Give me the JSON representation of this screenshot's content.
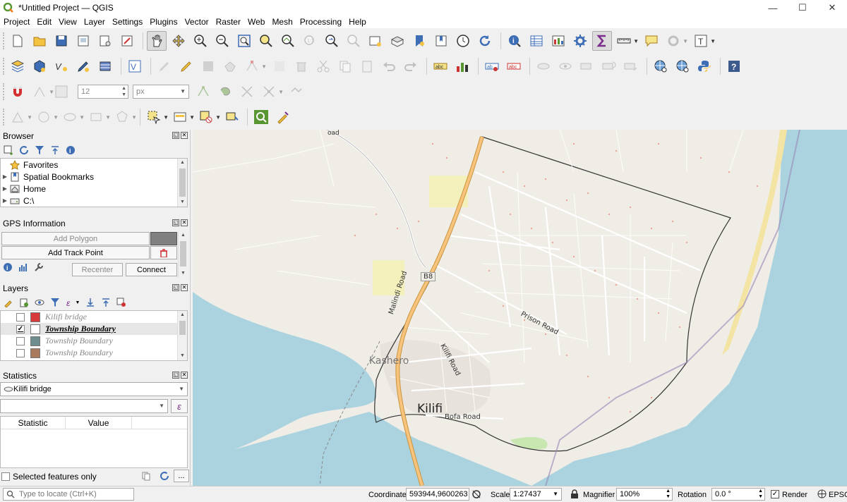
{
  "window": {
    "title": "*Untitled Project — QGIS",
    "controls": [
      "—",
      "☐",
      "✕"
    ]
  },
  "menu": [
    "Project",
    "Edit",
    "View",
    "Layer",
    "Settings",
    "Plugins",
    "Vector",
    "Raster",
    "Web",
    "Mesh",
    "Processing",
    "Help"
  ],
  "snapping": {
    "tolerance": "12",
    "units": "px"
  },
  "browser": {
    "title": "Browser",
    "items": [
      {
        "label": "Favorites",
        "icon": "star-icon"
      },
      {
        "label": "Spatial Bookmarks",
        "icon": "bookmark-icon"
      },
      {
        "label": "Home",
        "icon": "home-icon"
      },
      {
        "label": "C:\\",
        "icon": "drive-icon"
      }
    ]
  },
  "gps": {
    "title": "GPS Information",
    "add_polygon": "Add Polygon",
    "add_track_point": "Add Track Point",
    "recenter": "Recenter",
    "connect": "Connect"
  },
  "layers": {
    "title": "Layers",
    "items": [
      {
        "label": "Kilifi bridge",
        "checked": false,
        "color": "#d63a3a",
        "selected": false
      },
      {
        "label": "Township Boundary",
        "checked": true,
        "color": "#ffffff",
        "selected": true
      },
      {
        "label": "Township Boundary",
        "checked": false,
        "color": "#6f8d8e",
        "selected": false
      },
      {
        "label": "Township Boundary",
        "checked": false,
        "color": "#a97b5c",
        "selected": false
      }
    ]
  },
  "statistics": {
    "title": "Statistics",
    "layer": "Kilifi bridge",
    "field_value": "",
    "col_statistic": "Statistic",
    "col_value": "Value",
    "selected_only": "Selected features only"
  },
  "status": {
    "locate_placeholder": "Type to locate (Ctrl+K)",
    "coordinate_label": "Coordinate",
    "coordinate": "593944,9600263",
    "scale_label": "Scale",
    "scale": "1:27437",
    "magnifier_label": "Magnifier",
    "magnifier": "100%",
    "rotation_label": "Rotation",
    "rotation": "0.0 °",
    "render_label": "Render",
    "crs": "EPSG"
  },
  "map": {
    "labels": {
      "b8": "B8",
      "malindi_road": "Malindi Road",
      "prison_road": "Prison Road",
      "kilifi_road": "Kilifi Road",
      "kashero": "Kashero",
      "kilifi": "Kilifi",
      "bofa_road": "Bofa Road",
      "road_top": "oad"
    },
    "colors": {
      "water": "#aad3df",
      "land": "#f0ede6",
      "trunk": "#f7c37d",
      "boundary": "#333333",
      "beach": "#f4e4a4"
    }
  }
}
